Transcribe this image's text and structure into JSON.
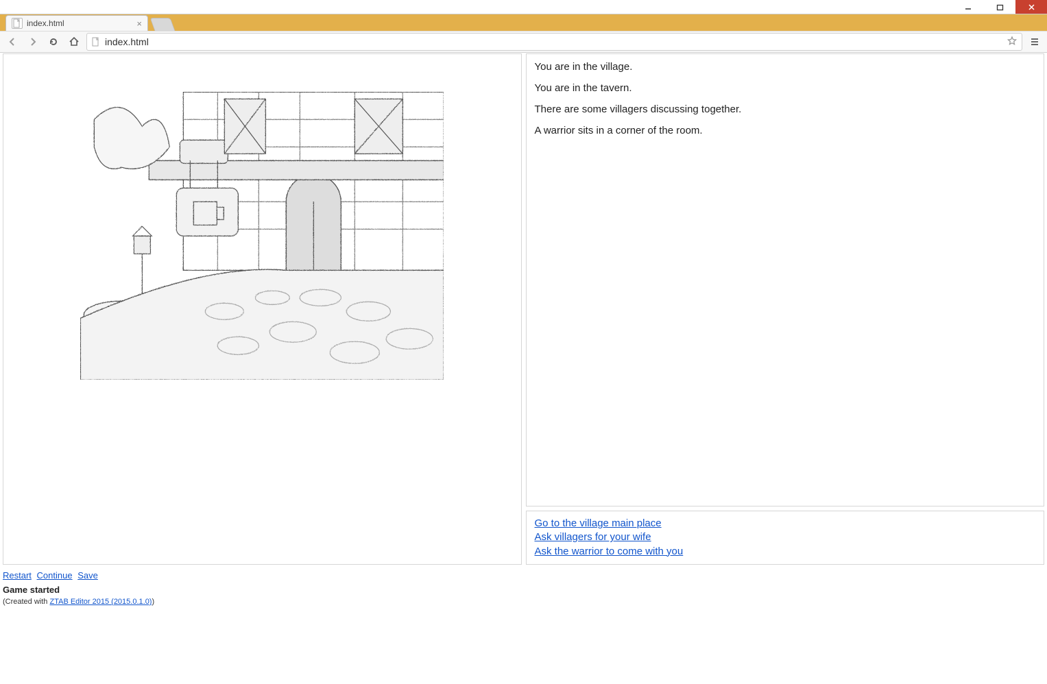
{
  "window": {
    "controls": {
      "minimize": "–",
      "maximize": "🗖",
      "close": "✕"
    }
  },
  "browser": {
    "tab_title": "index.html",
    "url": "index.html"
  },
  "story": {
    "lines": [
      "You are in the village.",
      "You are in the tavern.",
      "There are some villagers discussing together.",
      "A warrior sits in a corner of the room."
    ]
  },
  "choices": [
    "Go to the village main place",
    "Ask villagers for your wife",
    "Ask the warrior to come with you"
  ],
  "footer": {
    "links": [
      "Restart",
      "Continue",
      "Save"
    ],
    "status": "Game started",
    "credit_prefix": "(Created with ",
    "credit_link": "ZTAB Editor 2015 (2015.0.1.0)",
    "credit_suffix": ")"
  },
  "scene": {
    "alt": "tavern-sketch"
  }
}
